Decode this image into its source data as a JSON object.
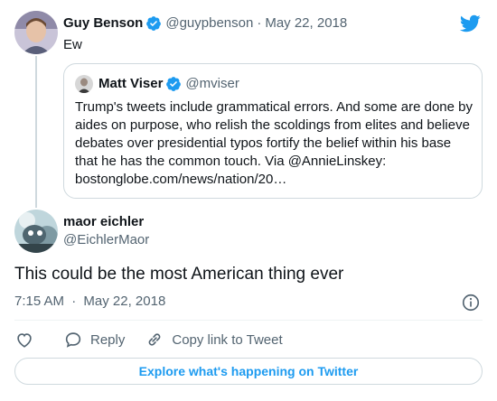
{
  "parent_tweet": {
    "author_name": "Guy Benson",
    "handle": "@guypbenson",
    "separator": "·",
    "date": "May 22, 2018",
    "text": "Ew",
    "verified": true
  },
  "quoted_tweet": {
    "author_name": "Matt Viser",
    "handle": "@mviser",
    "verified": true,
    "text": "Trump's tweets include grammatical errors. And some are done by aides on purpose, who relish the scoldings from elites and believe debates over presidential typos fortify the belief within his base that he has the common touch. Via @AnnieLinskey: bostonglobe.com/news/nation/20…"
  },
  "main_tweet": {
    "author_name": "maor eichler",
    "handle": "@EichlerMaor",
    "text": "This could be the most American thing ever",
    "time": "7:15 AM",
    "separator": "·",
    "date": "May 22, 2018"
  },
  "actions": {
    "reply_label": "Reply",
    "copy_link_label": "Copy link to Tweet"
  },
  "footer": {
    "explore_label": "Explore what's happening on Twitter"
  },
  "colors": {
    "accent": "#1d9bf0",
    "text": "#0f1419",
    "muted": "#536471",
    "border": "#cfd9de"
  },
  "icons": [
    "twitter-bird-icon",
    "verified-badge-icon",
    "info-icon",
    "heart-icon",
    "reply-icon",
    "link-icon"
  ]
}
